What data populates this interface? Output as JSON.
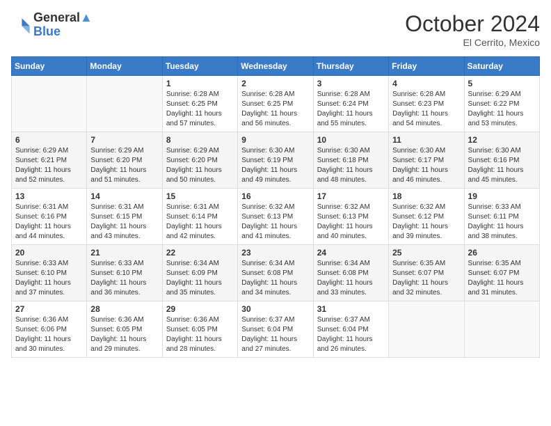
{
  "header": {
    "logo_line1": "General",
    "logo_line2": "Blue",
    "month": "October 2024",
    "location": "El Cerrito, Mexico"
  },
  "weekdays": [
    "Sunday",
    "Monday",
    "Tuesday",
    "Wednesday",
    "Thursday",
    "Friday",
    "Saturday"
  ],
  "weeks": [
    [
      {
        "day": "",
        "sunrise": "",
        "sunset": "",
        "daylight": ""
      },
      {
        "day": "",
        "sunrise": "",
        "sunset": "",
        "daylight": ""
      },
      {
        "day": "1",
        "sunrise": "Sunrise: 6:28 AM",
        "sunset": "Sunset: 6:25 PM",
        "daylight": "Daylight: 11 hours and 57 minutes."
      },
      {
        "day": "2",
        "sunrise": "Sunrise: 6:28 AM",
        "sunset": "Sunset: 6:25 PM",
        "daylight": "Daylight: 11 hours and 56 minutes."
      },
      {
        "day": "3",
        "sunrise": "Sunrise: 6:28 AM",
        "sunset": "Sunset: 6:24 PM",
        "daylight": "Daylight: 11 hours and 55 minutes."
      },
      {
        "day": "4",
        "sunrise": "Sunrise: 6:28 AM",
        "sunset": "Sunset: 6:23 PM",
        "daylight": "Daylight: 11 hours and 54 minutes."
      },
      {
        "day": "5",
        "sunrise": "Sunrise: 6:29 AM",
        "sunset": "Sunset: 6:22 PM",
        "daylight": "Daylight: 11 hours and 53 minutes."
      }
    ],
    [
      {
        "day": "6",
        "sunrise": "Sunrise: 6:29 AM",
        "sunset": "Sunset: 6:21 PM",
        "daylight": "Daylight: 11 hours and 52 minutes."
      },
      {
        "day": "7",
        "sunrise": "Sunrise: 6:29 AM",
        "sunset": "Sunset: 6:20 PM",
        "daylight": "Daylight: 11 hours and 51 minutes."
      },
      {
        "day": "8",
        "sunrise": "Sunrise: 6:29 AM",
        "sunset": "Sunset: 6:20 PM",
        "daylight": "Daylight: 11 hours and 50 minutes."
      },
      {
        "day": "9",
        "sunrise": "Sunrise: 6:30 AM",
        "sunset": "Sunset: 6:19 PM",
        "daylight": "Daylight: 11 hours and 49 minutes."
      },
      {
        "day": "10",
        "sunrise": "Sunrise: 6:30 AM",
        "sunset": "Sunset: 6:18 PM",
        "daylight": "Daylight: 11 hours and 48 minutes."
      },
      {
        "day": "11",
        "sunrise": "Sunrise: 6:30 AM",
        "sunset": "Sunset: 6:17 PM",
        "daylight": "Daylight: 11 hours and 46 minutes."
      },
      {
        "day": "12",
        "sunrise": "Sunrise: 6:30 AM",
        "sunset": "Sunset: 6:16 PM",
        "daylight": "Daylight: 11 hours and 45 minutes."
      }
    ],
    [
      {
        "day": "13",
        "sunrise": "Sunrise: 6:31 AM",
        "sunset": "Sunset: 6:16 PM",
        "daylight": "Daylight: 11 hours and 44 minutes."
      },
      {
        "day": "14",
        "sunrise": "Sunrise: 6:31 AM",
        "sunset": "Sunset: 6:15 PM",
        "daylight": "Daylight: 11 hours and 43 minutes."
      },
      {
        "day": "15",
        "sunrise": "Sunrise: 6:31 AM",
        "sunset": "Sunset: 6:14 PM",
        "daylight": "Daylight: 11 hours and 42 minutes."
      },
      {
        "day": "16",
        "sunrise": "Sunrise: 6:32 AM",
        "sunset": "Sunset: 6:13 PM",
        "daylight": "Daylight: 11 hours and 41 minutes."
      },
      {
        "day": "17",
        "sunrise": "Sunrise: 6:32 AM",
        "sunset": "Sunset: 6:13 PM",
        "daylight": "Daylight: 11 hours and 40 minutes."
      },
      {
        "day": "18",
        "sunrise": "Sunrise: 6:32 AM",
        "sunset": "Sunset: 6:12 PM",
        "daylight": "Daylight: 11 hours and 39 minutes."
      },
      {
        "day": "19",
        "sunrise": "Sunrise: 6:33 AM",
        "sunset": "Sunset: 6:11 PM",
        "daylight": "Daylight: 11 hours and 38 minutes."
      }
    ],
    [
      {
        "day": "20",
        "sunrise": "Sunrise: 6:33 AM",
        "sunset": "Sunset: 6:10 PM",
        "daylight": "Daylight: 11 hours and 37 minutes."
      },
      {
        "day": "21",
        "sunrise": "Sunrise: 6:33 AM",
        "sunset": "Sunset: 6:10 PM",
        "daylight": "Daylight: 11 hours and 36 minutes."
      },
      {
        "day": "22",
        "sunrise": "Sunrise: 6:34 AM",
        "sunset": "Sunset: 6:09 PM",
        "daylight": "Daylight: 11 hours and 35 minutes."
      },
      {
        "day": "23",
        "sunrise": "Sunrise: 6:34 AM",
        "sunset": "Sunset: 6:08 PM",
        "daylight": "Daylight: 11 hours and 34 minutes."
      },
      {
        "day": "24",
        "sunrise": "Sunrise: 6:34 AM",
        "sunset": "Sunset: 6:08 PM",
        "daylight": "Daylight: 11 hours and 33 minutes."
      },
      {
        "day": "25",
        "sunrise": "Sunrise: 6:35 AM",
        "sunset": "Sunset: 6:07 PM",
        "daylight": "Daylight: 11 hours and 32 minutes."
      },
      {
        "day": "26",
        "sunrise": "Sunrise: 6:35 AM",
        "sunset": "Sunset: 6:07 PM",
        "daylight": "Daylight: 11 hours and 31 minutes."
      }
    ],
    [
      {
        "day": "27",
        "sunrise": "Sunrise: 6:36 AM",
        "sunset": "Sunset: 6:06 PM",
        "daylight": "Daylight: 11 hours and 30 minutes."
      },
      {
        "day": "28",
        "sunrise": "Sunrise: 6:36 AM",
        "sunset": "Sunset: 6:05 PM",
        "daylight": "Daylight: 11 hours and 29 minutes."
      },
      {
        "day": "29",
        "sunrise": "Sunrise: 6:36 AM",
        "sunset": "Sunset: 6:05 PM",
        "daylight": "Daylight: 11 hours and 28 minutes."
      },
      {
        "day": "30",
        "sunrise": "Sunrise: 6:37 AM",
        "sunset": "Sunset: 6:04 PM",
        "daylight": "Daylight: 11 hours and 27 minutes."
      },
      {
        "day": "31",
        "sunrise": "Sunrise: 6:37 AM",
        "sunset": "Sunset: 6:04 PM",
        "daylight": "Daylight: 11 hours and 26 minutes."
      },
      {
        "day": "",
        "sunrise": "",
        "sunset": "",
        "daylight": ""
      },
      {
        "day": "",
        "sunrise": "",
        "sunset": "",
        "daylight": ""
      }
    ]
  ]
}
